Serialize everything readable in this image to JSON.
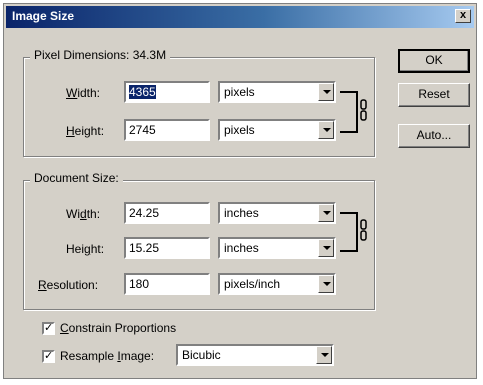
{
  "window": {
    "title": "Image Size",
    "close_glyph": "x"
  },
  "pixel_dimensions": {
    "legend": "Pixel Dimensions:",
    "size": "34.3M",
    "width": {
      "label": "Width:",
      "value": "4365",
      "unit": "pixels"
    },
    "height": {
      "label": "Height:",
      "value": "2745",
      "unit": "pixels"
    }
  },
  "document_size": {
    "legend": "Document Size:",
    "width": {
      "label": "Width:",
      "value": "24.25",
      "unit": "inches"
    },
    "height": {
      "label": "Height:",
      "value": "15.25",
      "unit": "inches"
    },
    "resolution": {
      "label": "Resolution:",
      "value": "180",
      "unit": "pixels/inch"
    }
  },
  "options": {
    "constrain": {
      "label": "Constrain Proportions",
      "checked": true
    },
    "resample": {
      "label": "Resample Image:",
      "checked": true,
      "method": "Bicubic"
    }
  },
  "buttons": {
    "ok": "OK",
    "reset": "Reset",
    "auto": "Auto..."
  },
  "icons": {
    "chain": "link-icon",
    "checkmark": "✓"
  },
  "colors": {
    "face": "#d4d0c8",
    "titlebar": "#0a246a",
    "selection": "#0a246a"
  }
}
